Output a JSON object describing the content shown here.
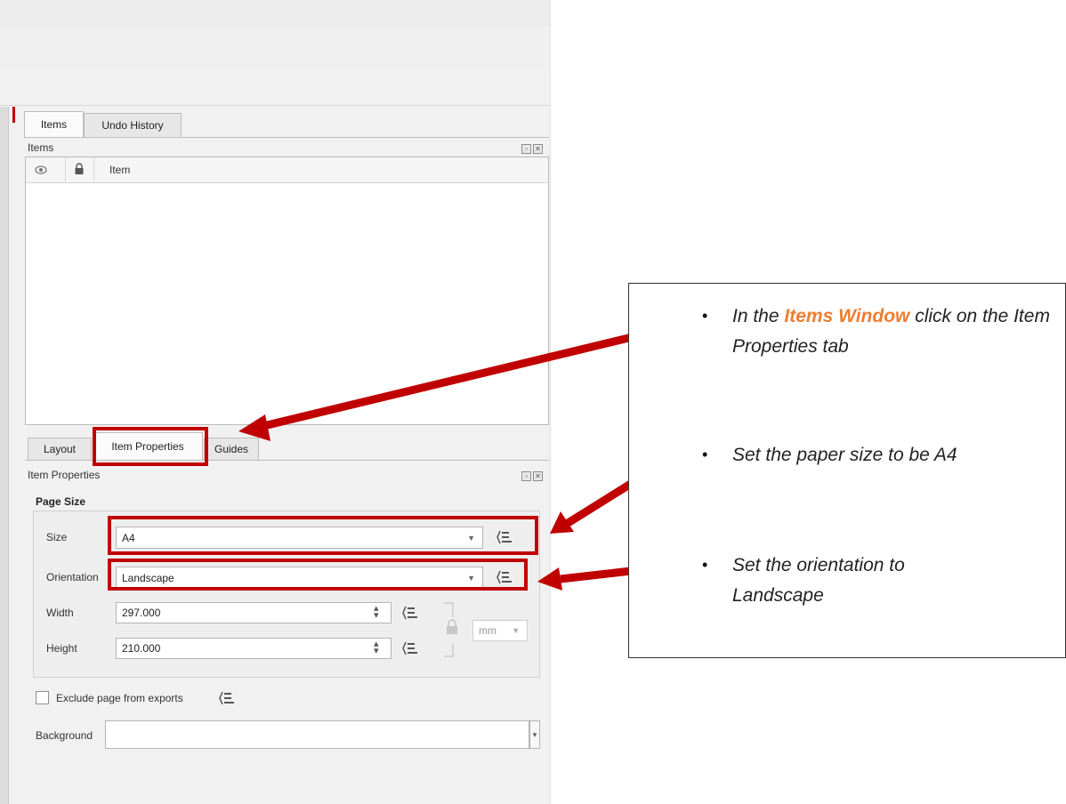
{
  "tabs_top": [
    {
      "label": "Items",
      "active": true
    },
    {
      "label": "Undo History",
      "active": false
    }
  ],
  "items_panel": {
    "title": "Items",
    "column_item": "Item"
  },
  "tabs_bottom": [
    {
      "label": "Layout",
      "active": false
    },
    {
      "label": "Item Properties",
      "active": true
    },
    {
      "label": "Guides",
      "active": false
    }
  ],
  "item_properties": {
    "title": "Item Properties",
    "page_size_group": "Page Size",
    "size_label": "Size",
    "size_value": "A4",
    "orientation_label": "Orientation",
    "orientation_value": "Landscape",
    "width_label": "Width",
    "width_value": "297.000",
    "height_label": "Height",
    "height_value": "210.000",
    "unit_value": "mm",
    "exclude_label": "Exclude page from exports",
    "exclude_checked": false,
    "background_label": "Background",
    "background_value": ""
  },
  "callout": {
    "instruction1_pre": "In the ",
    "instruction1_highlight": "Items Window",
    "instruction1_post": " click on the Item Properties tab",
    "instruction2": "Set the paper size to be A4",
    "instruction3": "Set the orientation to Landscape"
  },
  "colors": {
    "highlight_box": "#c00000",
    "arrow": "#c00000",
    "accent_text": "#ed7d31"
  },
  "icons": [
    "eye-icon",
    "lock-icon",
    "data-defined-icon",
    "lock-ratio-icon",
    "spin-arrows-icon",
    "dropdown-caret-icon"
  ]
}
